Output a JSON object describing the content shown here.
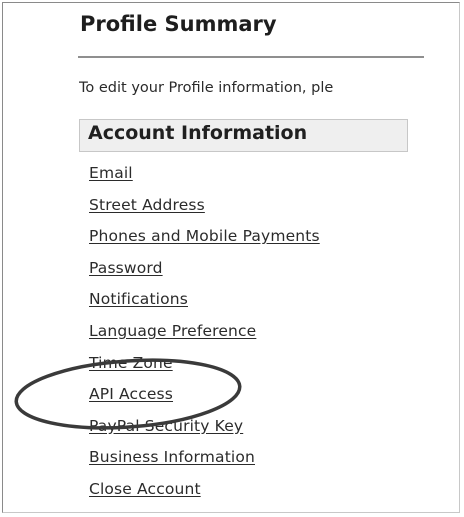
{
  "page": {
    "title": "Profile Summary",
    "intro": "To edit your Profile information, ple"
  },
  "account_section": {
    "title": "Account Information",
    "links": [
      {
        "label": "Email"
      },
      {
        "label": "Street Address"
      },
      {
        "label": "Phones and Mobile Payments"
      },
      {
        "label": "Password"
      },
      {
        "label": "Notifications"
      },
      {
        "label": "Language Preference"
      },
      {
        "label": "Time Zone"
      },
      {
        "label": "API Access"
      },
      {
        "label": "PayPal Security Key"
      },
      {
        "label": "Business Information"
      },
      {
        "label": "Close Account"
      }
    ]
  },
  "annotation": {
    "highlighted_item": "API Access",
    "color": "#3a3a3a"
  },
  "colors": {
    "text": "#222222",
    "rule": "#8f8f8f",
    "section_bg": "#efefef"
  }
}
